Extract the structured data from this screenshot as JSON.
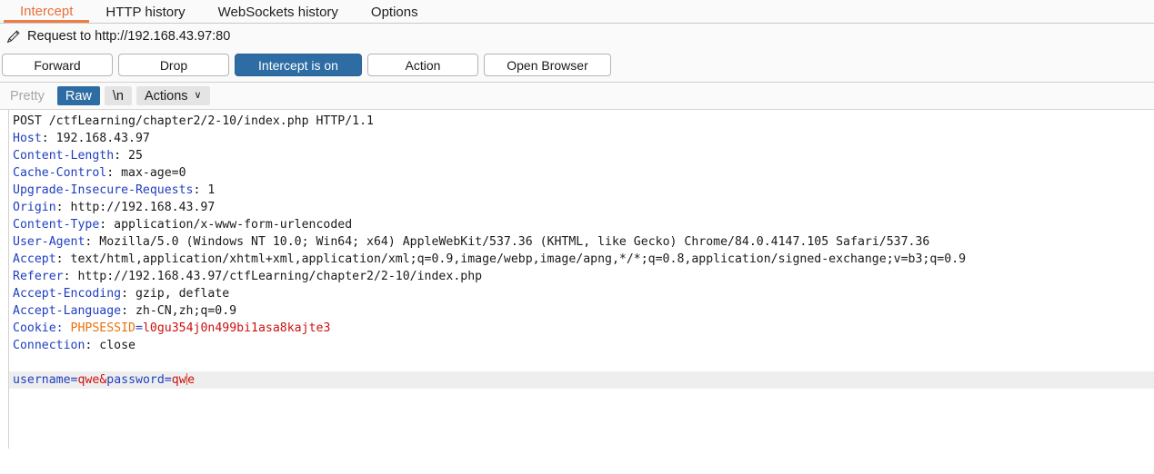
{
  "tabs": [
    {
      "label": "Intercept",
      "active": true
    },
    {
      "label": "HTTP history",
      "active": false
    },
    {
      "label": "WebSockets history",
      "active": false
    },
    {
      "label": "Options",
      "active": false
    }
  ],
  "request_header": {
    "icon": "pencil-icon",
    "title": "Request to http://192.168.43.97:80"
  },
  "buttons": [
    {
      "label": "Forward",
      "style": "normal"
    },
    {
      "label": "Drop",
      "style": "normal"
    },
    {
      "label": "Intercept is on",
      "style": "primary"
    },
    {
      "label": "Action",
      "style": "normal"
    },
    {
      "label": "Open Browser",
      "style": "wide"
    }
  ],
  "view_modes": [
    {
      "label": "Pretty",
      "state": "disabled"
    },
    {
      "label": "Raw",
      "state": "selected"
    },
    {
      "label": "\\n",
      "state": "grey"
    },
    {
      "label": "Actions",
      "state": "grey",
      "caret": "∨"
    }
  ],
  "colors": {
    "accent_orange": "#e8703a",
    "primary_blue": "#2e6da4",
    "header_key_blue": "#1f3fbf",
    "cookie_name_orange": "#e8730f",
    "value_red": "#cc1111",
    "chrome_bg": "#fafafa",
    "highlight_row": "#eeeeee"
  },
  "editor": {
    "caret_position": "after 'qw' in password value",
    "lines": [
      {
        "no": "1",
        "type": "request-line",
        "text": "POST /ctfLearning/chapter2/2-10/index.php HTTP/1.1"
      },
      {
        "no": "2",
        "type": "header",
        "name": "Host",
        "value": "192.168.43.97"
      },
      {
        "no": "3",
        "type": "header",
        "name": "Content-Length",
        "value": "25"
      },
      {
        "no": "4",
        "type": "header",
        "name": "Cache-Control",
        "value": "max-age=0"
      },
      {
        "no": "5",
        "type": "header",
        "name": "Upgrade-Insecure-Requests",
        "value": "1"
      },
      {
        "no": "6",
        "type": "header",
        "name": "Origin",
        "value": "http://192.168.43.97"
      },
      {
        "no": "7",
        "type": "header",
        "name": "Content-Type",
        "value": "application/x-www-form-urlencoded"
      },
      {
        "no": "8",
        "type": "header",
        "name": "User-Agent",
        "value": "Mozilla/5.0 (Windows NT 10.0; Win64; x64) AppleWebKit/537.36 (KHTML, like Gecko) Chrome/84.0.4147.105 Safari/537.36"
      },
      {
        "no": "9",
        "type": "header",
        "name": "Accept",
        "value": "text/html,application/xhtml+xml,application/xml;q=0.9,image/webp,image/apng,*/*;q=0.8,application/signed-exchange;v=b3;q=0.9"
      },
      {
        "no": "10",
        "type": "header",
        "name": "Referer",
        "value": "http://192.168.43.97/ctfLearning/chapter2/2-10/index.php"
      },
      {
        "no": "11",
        "type": "header",
        "name": "Accept-Encoding",
        "value": "gzip, deflate"
      },
      {
        "no": "12",
        "type": "header",
        "name": "Accept-Language",
        "value": "zh-CN,zh;q=0.9"
      },
      {
        "no": "13",
        "type": "cookie",
        "name": "Cookie",
        "cookie_name": "PHPSESSID",
        "cookie_value": "l0gu354j0n499bi1asa8kajte3"
      },
      {
        "no": "14",
        "type": "header",
        "name": "Connection",
        "value": "close"
      },
      {
        "no": "15",
        "type": "blank"
      },
      {
        "no": "16",
        "type": "body",
        "params": [
          {
            "name": "username",
            "value": "qwe"
          },
          {
            "name": "password",
            "value_before_caret": "qw",
            "value_after_caret": "e"
          }
        ]
      }
    ]
  }
}
